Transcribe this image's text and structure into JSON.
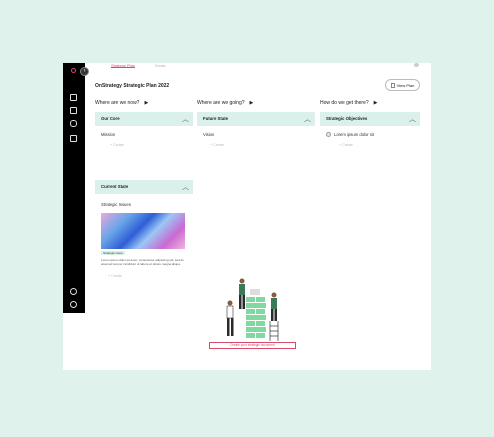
{
  "tabs": [
    {
      "label": "Strategy Plan"
    },
    {
      "label": "Goals"
    }
  ],
  "title": "OnStrategy Strategic Plan 2022",
  "view_button": {
    "label": "View Plan"
  },
  "questions": [
    {
      "text": "Where are we now?"
    },
    {
      "text": "Where are we going?"
    },
    {
      "text": "How do we get there?"
    }
  ],
  "cards": {
    "our_core": {
      "title": "Our Core",
      "item": "Mission",
      "create": "Create"
    },
    "future_state": {
      "title": "Future State",
      "item": "Vision",
      "create": "Create"
    },
    "strategic_objectives": {
      "title": "Strategic Objectives",
      "item": "Lorem ipsum dolor sit",
      "create": "Create"
    },
    "current_state": {
      "title": "Current State",
      "item": "Strategic Issues",
      "tag": "Strategic issue",
      "description": "Lorem ipsum dolor sit amet, consectetur adipiscing elit, sed do eiusmod tempor incididunt ut labore et dolore magna aliqua.",
      "create": "Create"
    }
  },
  "cta": {
    "label": "Create your strategic document"
  },
  "colors": {
    "accent": "#d94b6a",
    "mint": "#d9f1ea",
    "sidebar": "#000000"
  }
}
